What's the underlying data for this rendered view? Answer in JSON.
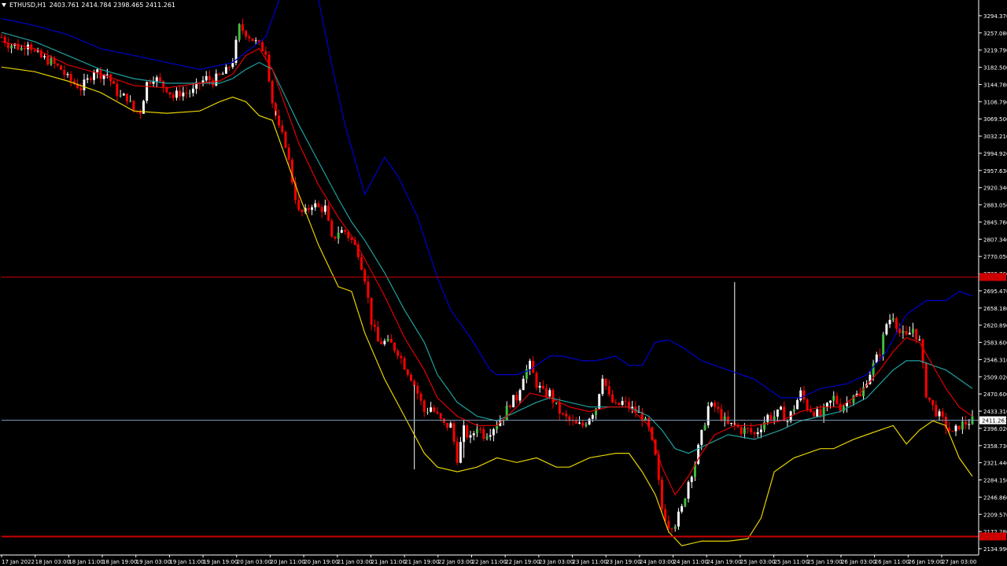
{
  "window": {
    "symbol": "ETHUSD,H1",
    "ohlc": "2403.761 2414.784 2398.465 2411.261"
  },
  "colors": {
    "background": "#000000",
    "bull": "#ffffff",
    "bull_body_alt": "#3fbf3f",
    "bear": "#ff0000",
    "upper_band": "#0000cc",
    "lower_band": "#e6d200",
    "ma_fast": "#e00000",
    "ma_slow": "#20a0a0",
    "resistance_line": "#cc0000",
    "price_line": "#7f9fbf",
    "axis_text": "#ffffff"
  },
  "chart_data": {
    "type": "candlestick",
    "y_range": [
      2120,
      3320
    ],
    "y_ticks": [
      "3294.370",
      "3257.080",
      "3219.790",
      "3182.500",
      "3144.780",
      "3106.790",
      "3069.500",
      "3032.210",
      "2994.920",
      "2957.630",
      "2920.340",
      "2883.050",
      "2845.760",
      "2807.340",
      "2770.050",
      "2732.760",
      "2695.470",
      "2658.180",
      "2620.890",
      "2583.600",
      "2546.310",
      "2509.020",
      "2470.600",
      "2433.310",
      "2396.020",
      "2358.730",
      "2321.440",
      "2284.150",
      "2246.860",
      "2209.570",
      "2172.280",
      "2134.990"
    ],
    "x_ticks": [
      "17 Jan 2022",
      "18 Jan 03:00",
      "18 Jan 11:00",
      "18 Jan 19:00",
      "19 Jan 03:00",
      "19 Jan 11:00",
      "19 Jan 19:00",
      "20 Jan 03:00",
      "20 Jan 11:00",
      "20 Jan 19:00",
      "21 Jan 03:00",
      "21 Jan 11:00",
      "21 Jan 19:00",
      "22 Jan 03:00",
      "22 Jan 11:00",
      "22 Jan 19:00",
      "23 Jan 03:00",
      "23 Jan 11:00",
      "23 Jan 19:00",
      "24 Jan 03:00",
      "24 Jan 11:00",
      "24 Jan 19:00",
      "25 Jan 03:00",
      "25 Jan 11:00",
      "25 Jan 19:00",
      "26 Jan 03:00",
      "26 Jan 11:00",
      "26 Jan 19:00",
      "27 Jan 03:00"
    ],
    "price_label": "2411.261",
    "resistance_price": 2721,
    "support_price": 2160,
    "price_level": 2411.261,
    "close_path": [
      [
        0,
        3240
      ],
      [
        2,
        3225
      ],
      [
        4,
        3222
      ],
      [
        6,
        3215
      ],
      [
        8,
        3232
      ],
      [
        10,
        3205
      ],
      [
        12,
        3195
      ],
      [
        14,
        3190
      ],
      [
        16,
        3180
      ],
      [
        18,
        3170
      ],
      [
        20,
        3150
      ],
      [
        22,
        3140
      ],
      [
        24,
        3130
      ],
      [
        26,
        3145
      ],
      [
        28,
        3170
      ],
      [
        30,
        3160
      ],
      [
        32,
        3160
      ],
      [
        34,
        3130
      ],
      [
        36,
        3110
      ],
      [
        38,
        3110
      ],
      [
        40,
        3080
      ],
      [
        42,
        3080
      ],
      [
        44,
        3140
      ],
      [
        46,
        3155
      ],
      [
        48,
        3140
      ],
      [
        50,
        3130
      ],
      [
        52,
        3110
      ],
      [
        54,
        3120
      ],
      [
        56,
        3120
      ],
      [
        58,
        3122
      ],
      [
        60,
        3140
      ],
      [
        62,
        3150
      ],
      [
        64,
        3145
      ],
      [
        66,
        3155
      ],
      [
        68,
        3165
      ],
      [
        70,
        3190
      ],
      [
        72,
        3260
      ],
      [
        74,
        3250
      ],
      [
        76,
        3235
      ],
      [
        78,
        3220
      ],
      [
        80,
        3210
      ],
      [
        82,
        3100
      ],
      [
        84,
        3040
      ],
      [
        86,
        3010
      ],
      [
        88,
        2930
      ],
      [
        90,
        2860
      ],
      [
        92,
        2860
      ],
      [
        94,
        2880
      ],
      [
        96,
        2870
      ],
      [
        98,
        2870
      ],
      [
        100,
        2800
      ],
      [
        102,
        2820
      ],
      [
        104,
        2820
      ],
      [
        106,
        2800
      ],
      [
        108,
        2775
      ],
      [
        110,
        2720
      ],
      [
        112,
        2625
      ],
      [
        114,
        2580
      ],
      [
        116,
        2580
      ],
      [
        118,
        2575
      ],
      [
        120,
        2560
      ],
      [
        122,
        2530
      ],
      [
        124,
        2505
      ],
      [
        126,
        2470
      ],
      [
        128,
        2430
      ],
      [
        130,
        2440
      ],
      [
        132,
        2420
      ],
      [
        134,
        2400
      ],
      [
        136,
        2400
      ],
      [
        138,
        2330
      ],
      [
        140,
        2390
      ],
      [
        142,
        2370
      ],
      [
        144,
        2400
      ],
      [
        146,
        2380
      ],
      [
        148,
        2390
      ],
      [
        150,
        2405
      ],
      [
        152,
        2420
      ],
      [
        154,
        2450
      ],
      [
        156,
        2460
      ],
      [
        158,
        2510
      ],
      [
        160,
        2530
      ],
      [
        162,
        2490
      ],
      [
        164,
        2470
      ],
      [
        166,
        2470
      ],
      [
        168,
        2440
      ],
      [
        170,
        2420
      ],
      [
        172,
        2410
      ],
      [
        174,
        2400
      ],
      [
        176,
        2400
      ],
      [
        178,
        2420
      ],
      [
        180,
        2440
      ],
      [
        182,
        2510
      ],
      [
        184,
        2460
      ],
      [
        186,
        2440
      ],
      [
        188,
        2450
      ],
      [
        190,
        2440
      ],
      [
        192,
        2430
      ],
      [
        194,
        2420
      ],
      [
        196,
        2390
      ],
      [
        198,
        2330
      ],
      [
        200,
        2220
      ],
      [
        202,
        2185
      ],
      [
        204,
        2190
      ],
      [
        206,
        2220
      ],
      [
        208,
        2280
      ],
      [
        210,
        2320
      ],
      [
        212,
        2380
      ],
      [
        214,
        2440
      ],
      [
        216,
        2440
      ],
      [
        218,
        2420
      ],
      [
        220,
        2400
      ],
      [
        222,
        2400
      ],
      [
        224,
        2390
      ],
      [
        226,
        2390
      ],
      [
        228,
        2380
      ],
      [
        230,
        2400
      ],
      [
        232,
        2420
      ],
      [
        234,
        2420
      ],
      [
        236,
        2430
      ],
      [
        238,
        2410
      ],
      [
        240,
        2440
      ],
      [
        242,
        2470
      ],
      [
        244,
        2440
      ],
      [
        246,
        2430
      ],
      [
        248,
        2420
      ],
      [
        250,
        2440
      ],
      [
        252,
        2460
      ],
      [
        254,
        2440
      ],
      [
        256,
        2450
      ],
      [
        258,
        2470
      ],
      [
        260,
        2460
      ],
      [
        262,
        2500
      ],
      [
        264,
        2530
      ],
      [
        266,
        2560
      ],
      [
        268,
        2620
      ],
      [
        270,
        2640
      ],
      [
        272,
        2600
      ],
      [
        274,
        2590
      ],
      [
        276,
        2610
      ],
      [
        278,
        2580
      ],
      [
        280,
        2470
      ],
      [
        282,
        2440
      ],
      [
        284,
        2420
      ],
      [
        286,
        2400
      ],
      [
        288,
        2380
      ],
      [
        290,
        2400
      ],
      [
        292,
        2405
      ],
      [
        294,
        2411
      ]
    ],
    "upper_band": [
      [
        0,
        3280
      ],
      [
        10,
        3265
      ],
      [
        20,
        3245
      ],
      [
        30,
        3215
      ],
      [
        40,
        3200
      ],
      [
        50,
        3185
      ],
      [
        60,
        3170
      ],
      [
        70,
        3185
      ],
      [
        80,
        3240
      ],
      [
        84,
        3320
      ],
      [
        86,
        3360
      ],
      [
        90,
        3360
      ],
      [
        96,
        3320
      ],
      [
        100,
        3180
      ],
      [
        104,
        3050
      ],
      [
        110,
        2900
      ],
      [
        116,
        2980
      ],
      [
        120,
        2940
      ],
      [
        126,
        2850
      ],
      [
        132,
        2720
      ],
      [
        136,
        2650
      ],
      [
        142,
        2590
      ],
      [
        148,
        2520
      ],
      [
        150,
        2510
      ],
      [
        156,
        2510
      ],
      [
        160,
        2520
      ],
      [
        166,
        2550
      ],
      [
        170,
        2550
      ],
      [
        176,
        2540
      ],
      [
        180,
        2540
      ],
      [
        186,
        2550
      ],
      [
        190,
        2530
      ],
      [
        194,
        2530
      ],
      [
        198,
        2580
      ],
      [
        202,
        2585
      ],
      [
        206,
        2570
      ],
      [
        212,
        2540
      ],
      [
        220,
        2520
      ],
      [
        228,
        2500
      ],
      [
        236,
        2460
      ],
      [
        242,
        2460
      ],
      [
        248,
        2480
      ],
      [
        256,
        2490
      ],
      [
        262,
        2510
      ],
      [
        268,
        2560
      ],
      [
        274,
        2640
      ],
      [
        280,
        2670
      ],
      [
        286,
        2670
      ],
      [
        290,
        2690
      ],
      [
        294,
        2680
      ]
    ],
    "lower_band": [
      [
        0,
        3175
      ],
      [
        10,
        3165
      ],
      [
        20,
        3145
      ],
      [
        30,
        3120
      ],
      [
        40,
        3080
      ],
      [
        50,
        3075
      ],
      [
        60,
        3080
      ],
      [
        66,
        3100
      ],
      [
        70,
        3110
      ],
      [
        74,
        3100
      ],
      [
        78,
        3070
      ],
      [
        82,
        3060
      ],
      [
        86,
        2980
      ],
      [
        90,
        2900
      ],
      [
        96,
        2790
      ],
      [
        102,
        2700
      ],
      [
        106,
        2690
      ],
      [
        110,
        2600
      ],
      [
        116,
        2500
      ],
      [
        122,
        2420
      ],
      [
        128,
        2340
      ],
      [
        132,
        2310
      ],
      [
        138,
        2300
      ],
      [
        144,
        2310
      ],
      [
        150,
        2330
      ],
      [
        156,
        2320
      ],
      [
        162,
        2330
      ],
      [
        168,
        2310
      ],
      [
        172,
        2310
      ],
      [
        178,
        2330
      ],
      [
        186,
        2340
      ],
      [
        190,
        2340
      ],
      [
        194,
        2300
      ],
      [
        198,
        2250
      ],
      [
        202,
        2170
      ],
      [
        206,
        2140
      ],
      [
        212,
        2150
      ],
      [
        220,
        2150
      ],
      [
        226,
        2155
      ],
      [
        230,
        2200
      ],
      [
        234,
        2300
      ],
      [
        240,
        2330
      ],
      [
        244,
        2340
      ],
      [
        248,
        2350
      ],
      [
        252,
        2350
      ],
      [
        258,
        2370
      ],
      [
        262,
        2380
      ],
      [
        266,
        2390
      ],
      [
        270,
        2400
      ],
      [
        274,
        2360
      ],
      [
        278,
        2390
      ],
      [
        282,
        2410
      ],
      [
        286,
        2400
      ],
      [
        290,
        2330
      ],
      [
        294,
        2290
      ]
    ],
    "ma_fast": [
      [
        0,
        3230
      ],
      [
        10,
        3215
      ],
      [
        20,
        3180
      ],
      [
        30,
        3160
      ],
      [
        40,
        3135
      ],
      [
        50,
        3130
      ],
      [
        60,
        3140
      ],
      [
        66,
        3145
      ],
      [
        70,
        3160
      ],
      [
        74,
        3200
      ],
      [
        78,
        3215
      ],
      [
        82,
        3170
      ],
      [
        86,
        3090
      ],
      [
        90,
        3010
      ],
      [
        96,
        2920
      ],
      [
        102,
        2850
      ],
      [
        106,
        2810
      ],
      [
        110,
        2760
      ],
      [
        116,
        2680
      ],
      [
        122,
        2590
      ],
      [
        128,
        2520
      ],
      [
        132,
        2460
      ],
      [
        138,
        2420
      ],
      [
        144,
        2400
      ],
      [
        150,
        2400
      ],
      [
        156,
        2440
      ],
      [
        160,
        2470
      ],
      [
        166,
        2460
      ],
      [
        172,
        2440
      ],
      [
        178,
        2430
      ],
      [
        184,
        2440
      ],
      [
        190,
        2440
      ],
      [
        196,
        2400
      ],
      [
        200,
        2310
      ],
      [
        204,
        2250
      ],
      [
        208,
        2290
      ],
      [
        212,
        2340
      ],
      [
        216,
        2380
      ],
      [
        222,
        2400
      ],
      [
        228,
        2400
      ],
      [
        236,
        2410
      ],
      [
        242,
        2430
      ],
      [
        248,
        2440
      ],
      [
        254,
        2440
      ],
      [
        260,
        2470
      ],
      [
        266,
        2520
      ],
      [
        270,
        2560
      ],
      [
        274,
        2590
      ],
      [
        278,
        2580
      ],
      [
        282,
        2530
      ],
      [
        286,
        2480
      ],
      [
        290,
        2440
      ],
      [
        294,
        2420
      ]
    ],
    "ma_slow": [
      [
        0,
        3250
      ],
      [
        10,
        3230
      ],
      [
        20,
        3200
      ],
      [
        30,
        3170
      ],
      [
        40,
        3150
      ],
      [
        50,
        3140
      ],
      [
        60,
        3140
      ],
      [
        66,
        3140
      ],
      [
        70,
        3150
      ],
      [
        74,
        3170
      ],
      [
        78,
        3185
      ],
      [
        82,
        3170
      ],
      [
        86,
        3110
      ],
      [
        90,
        3050
      ],
      [
        96,
        2970
      ],
      [
        102,
        2890
      ],
      [
        106,
        2840
      ],
      [
        110,
        2800
      ],
      [
        116,
        2730
      ],
      [
        122,
        2650
      ],
      [
        128,
        2580
      ],
      [
        132,
        2510
      ],
      [
        138,
        2450
      ],
      [
        144,
        2420
      ],
      [
        150,
        2410
      ],
      [
        156,
        2430
      ],
      [
        162,
        2450
      ],
      [
        166,
        2460
      ],
      [
        172,
        2450
      ],
      [
        178,
        2440
      ],
      [
        184,
        2440
      ],
      [
        190,
        2440
      ],
      [
        196,
        2420
      ],
      [
        200,
        2390
      ],
      [
        204,
        2350
      ],
      [
        208,
        2340
      ],
      [
        214,
        2360
      ],
      [
        220,
        2380
      ],
      [
        228,
        2370
      ],
      [
        236,
        2390
      ],
      [
        242,
        2410
      ],
      [
        248,
        2420
      ],
      [
        254,
        2430
      ],
      [
        262,
        2460
      ],
      [
        266,
        2490
      ],
      [
        270,
        2520
      ],
      [
        274,
        2540
      ],
      [
        278,
        2540
      ],
      [
        282,
        2530
      ],
      [
        286,
        2520
      ],
      [
        290,
        2500
      ],
      [
        294,
        2480
      ]
    ],
    "spikes": [
      [
        222,
        2710
      ],
      [
        125,
        2305
      ],
      [
        83,
        3080
      ],
      [
        140,
        2330
      ]
    ]
  }
}
